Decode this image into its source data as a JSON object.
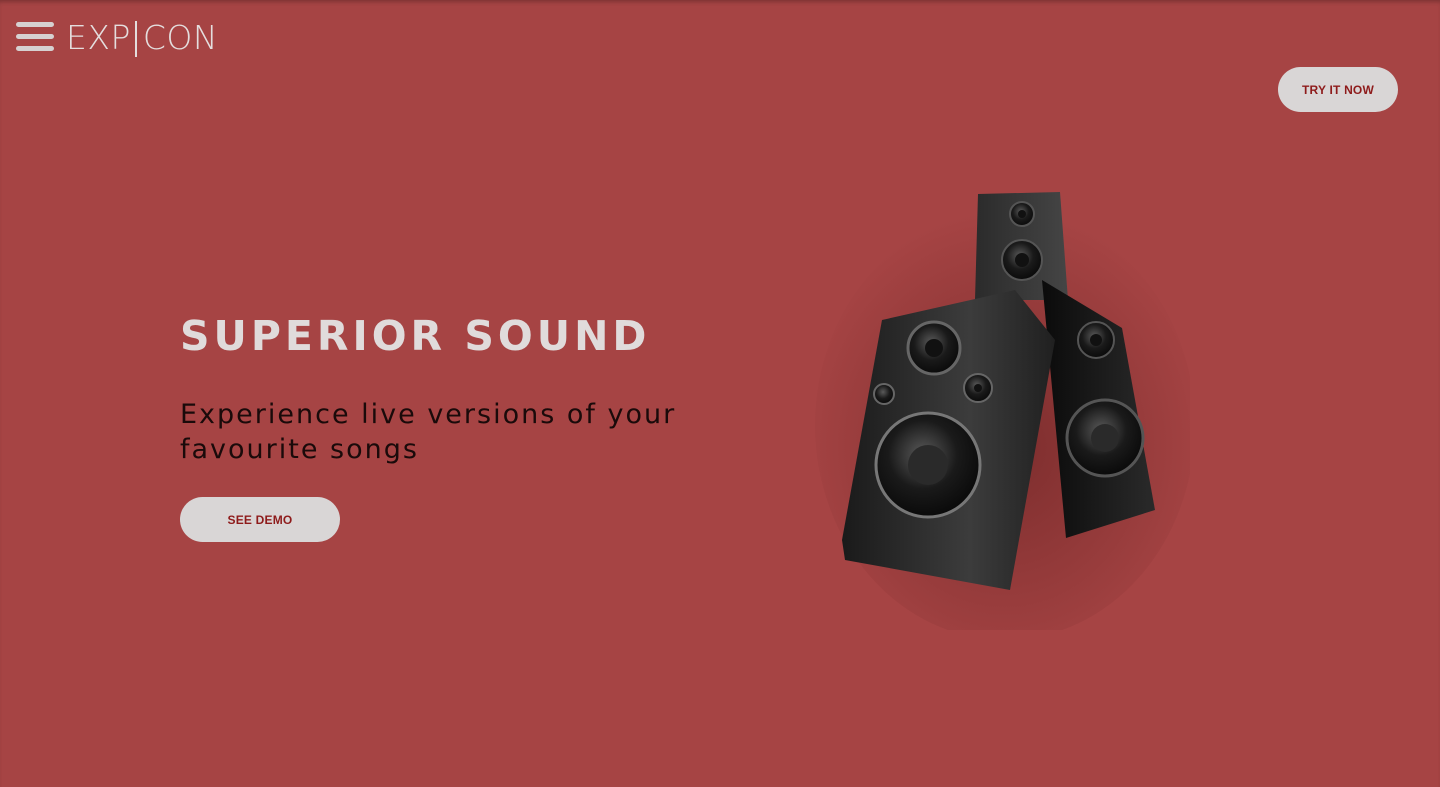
{
  "header": {
    "logo_left": "EXP",
    "logo_right": "CON",
    "cta_label": "TRY IT NOW"
  },
  "hero": {
    "title": "SUPERIOR SOUND",
    "subtitle": "Experience live versions of your favourite songs",
    "demo_label": "SEE DEMO"
  },
  "icons": {
    "menu": "hamburger-menu-icon",
    "hero_image": "speakers-image"
  },
  "colors": {
    "background": "#a64444",
    "button_bg": "#d9d6d6",
    "button_text": "#8e1b1b",
    "title": "#e0dbdb",
    "subtitle": "#1a0a0a"
  }
}
